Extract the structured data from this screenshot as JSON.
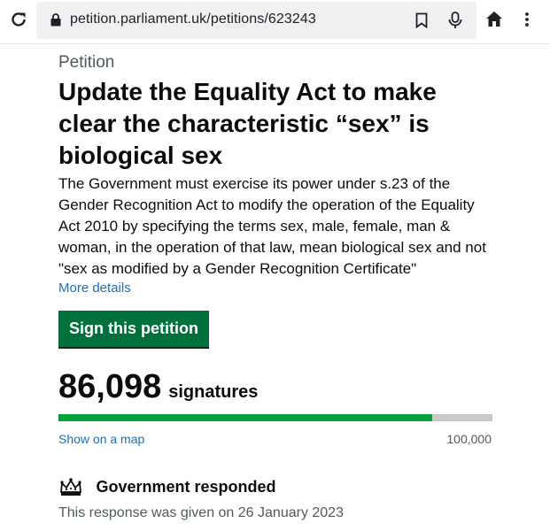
{
  "browser": {
    "url": "petition.parliament.uk/petitions/623243",
    "icons": [
      "reload-icon",
      "lock-icon",
      "bookmark-icon",
      "mic-icon",
      "home-icon",
      "menu-dots-icon"
    ]
  },
  "petition": {
    "caption": "Petition",
    "title": "Update the Equality Act to make clear the characteristic “sex” is biological sex",
    "action": "The Government must exercise its power under s.23 of the Gender Recognition Act to modify the operation of the Equality Act 2010 by specifying the terms sex, male, female, man & woman, in the operation of that law, mean biological sex and not \"sex as modified by a Gender Recognition Certificate\"",
    "more_details": "More details",
    "sign_button": "Sign this petition"
  },
  "signatures": {
    "count": "86,098",
    "label": "signatures",
    "progress_fraction": 0.861,
    "map_link": "Show on a map",
    "threshold": "100,000"
  },
  "response": {
    "heading": "Government responded",
    "date_text": "This response was given on 26 January 2023"
  },
  "colors": {
    "link": "#1d70b8",
    "button": "#00703c",
    "progress_fill": "#00a33b",
    "progress_track": "#c8c8c8"
  }
}
